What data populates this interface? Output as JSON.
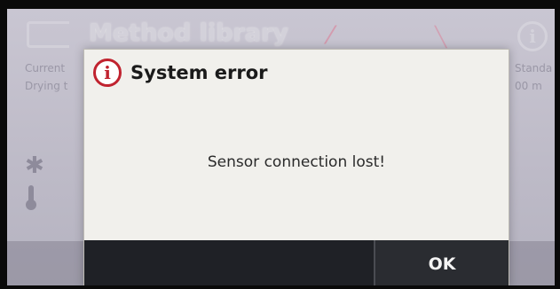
{
  "background": {
    "title": "Method library",
    "left_rows": [
      "Current",
      "Drying t"
    ],
    "right_rows": [
      "Standa",
      "00 m"
    ],
    "info_symbol": "i",
    "asterisk_symbol": "✱",
    "thermometer_symbol": "🌡"
  },
  "dialog": {
    "icon_symbol": "i",
    "title": "System error",
    "message": "Sensor connection lost!",
    "ok_label": "OK"
  }
}
